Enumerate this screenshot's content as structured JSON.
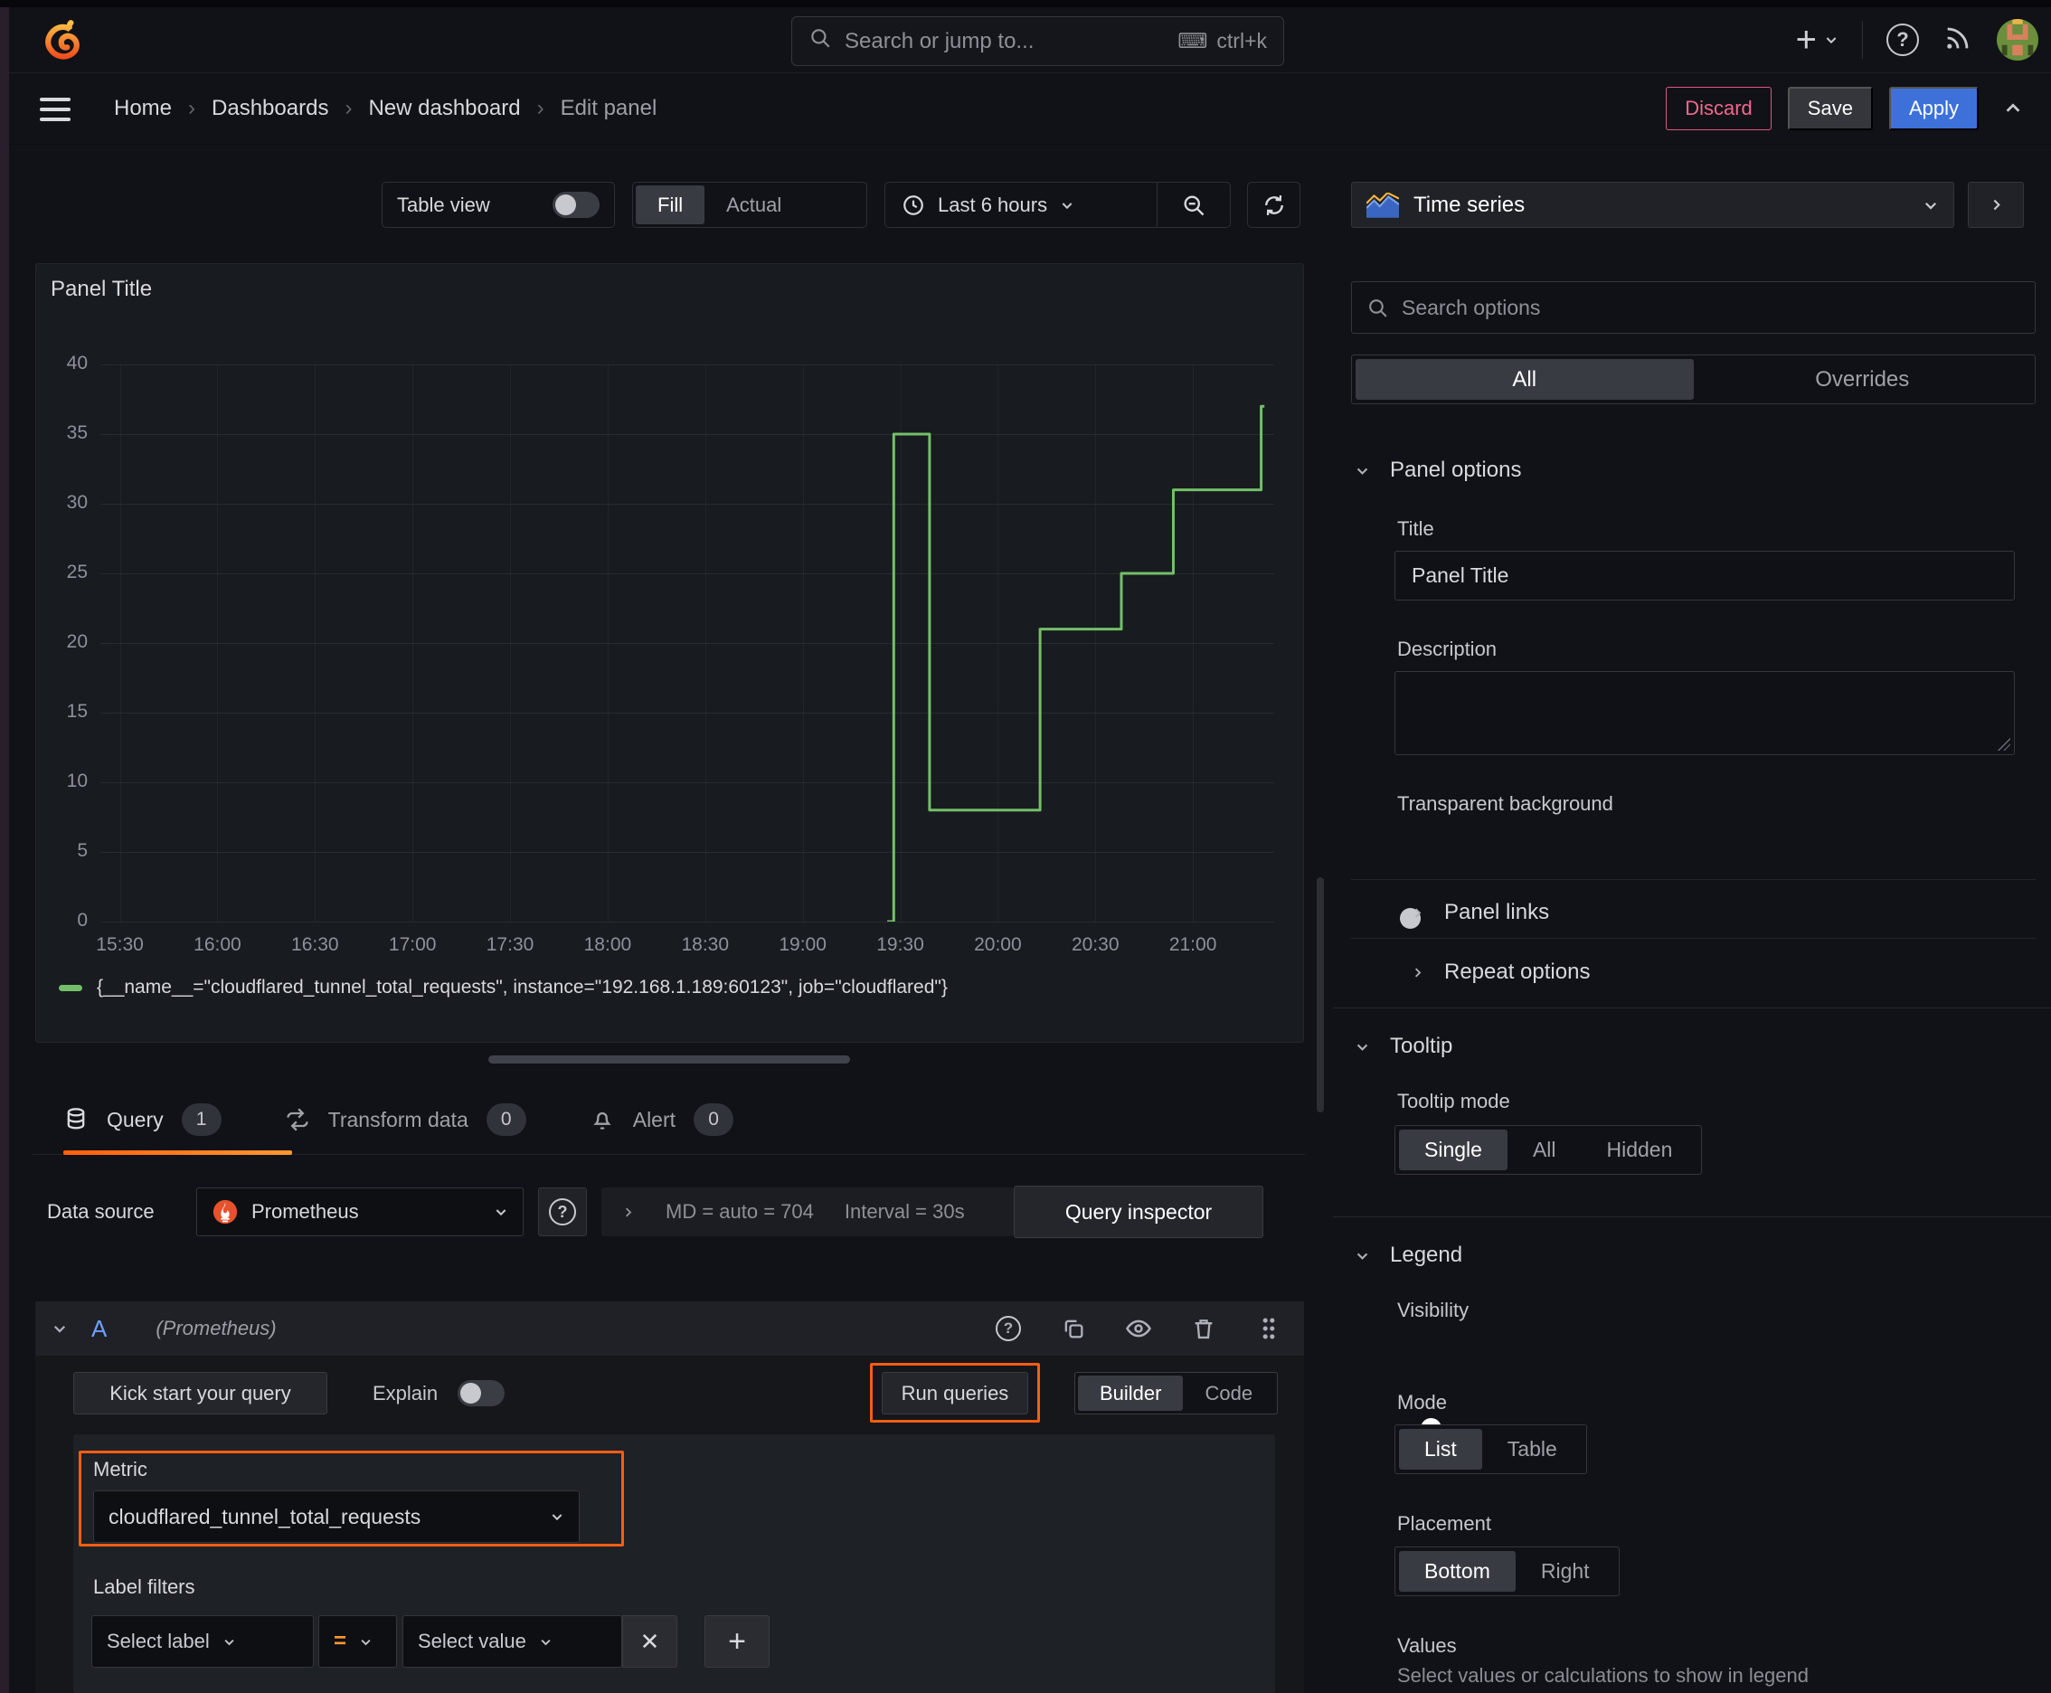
{
  "colors": {
    "accent_orange": "#f55e13",
    "series_green": "#73bf69",
    "primary_blue": "#3d71d9",
    "danger_pink": "#f1688f",
    "tab_underline_from": "#ff5f0e",
    "tab_underline_to": "#ff9830"
  },
  "topnav": {
    "search_placeholder": "Search or jump to...",
    "shortcut": "ctrl+k"
  },
  "breadcrumb": {
    "items": [
      "Home",
      "Dashboards",
      "New dashboard",
      "Edit panel"
    ]
  },
  "actions": {
    "discard": "Discard",
    "save": "Save",
    "apply": "Apply"
  },
  "panel_toolbar": {
    "table_view_label": "Table view",
    "fit_options": [
      "Fill",
      "Actual"
    ],
    "fit_selected": "Fill",
    "time_range": "Last 6 hours"
  },
  "viz_picker": {
    "label": "Time series"
  },
  "panel": {
    "title": "Panel Title"
  },
  "chart_data": {
    "type": "line",
    "step": true,
    "title": "Panel Title",
    "xlabel": "",
    "ylabel": "",
    "grid": true,
    "legend_position": "bottom",
    "x_ticks": [
      "15:30",
      "16:00",
      "16:30",
      "17:00",
      "17:30",
      "18:00",
      "18:30",
      "19:00",
      "19:30",
      "20:00",
      "20:30",
      "21:00"
    ],
    "x_domain_minutes": [
      924,
      1285
    ],
    "y_ticks": [
      0,
      5,
      10,
      15,
      20,
      25,
      30,
      35,
      40
    ],
    "ylim": [
      0,
      40
    ],
    "series": [
      {
        "name": "{__name__=\"cloudflared_tunnel_total_requests\", instance=\"192.168.1.189:60123\", job=\"cloudflared\"}",
        "color": "#73bf69",
        "points": [
          {
            "t": "19:26",
            "v": 0
          },
          {
            "t": "19:28",
            "v": 0
          },
          {
            "t": "19:28",
            "v": 35
          },
          {
            "t": "19:39",
            "v": 35
          },
          {
            "t": "19:39",
            "v": 8
          },
          {
            "t": "20:13",
            "v": 8
          },
          {
            "t": "20:13",
            "v": 21
          },
          {
            "t": "20:38",
            "v": 21
          },
          {
            "t": "20:38",
            "v": 25
          },
          {
            "t": "20:54",
            "v": 25
          },
          {
            "t": "20:54",
            "v": 31
          },
          {
            "t": "21:21",
            "v": 31
          },
          {
            "t": "21:21",
            "v": 37
          },
          {
            "t": "21:22",
            "v": 37
          }
        ]
      }
    ]
  },
  "editor": {
    "tabs": [
      {
        "label": "Query",
        "count": "1"
      },
      {
        "label": "Transform data",
        "count": "0"
      },
      {
        "label": "Alert",
        "count": "0"
      }
    ],
    "datasource": {
      "label": "Data source",
      "name": "Prometheus",
      "stats_md": "MD = auto = 704",
      "stats_interval": "Interval = 30s",
      "query_inspector": "Query inspector"
    },
    "query": {
      "ref_id": "A",
      "ds_hint": "(Prometheus)",
      "kick_start": "Kick start your query",
      "explain": "Explain",
      "run_queries": "Run queries",
      "mode_options": [
        "Builder",
        "Code"
      ],
      "mode_selected": "Builder",
      "metric_label": "Metric",
      "metric_value": "cloudflared_tunnel_total_requests",
      "label_filters_label": "Label filters",
      "select_label_placeholder": "Select label",
      "operator": "=",
      "select_value_placeholder": "Select value"
    }
  },
  "options_pane": {
    "search_placeholder": "Search options",
    "tabs": [
      "All",
      "Overrides"
    ],
    "tab_selected": "All",
    "panel_options": {
      "heading": "Panel options",
      "title_label": "Title",
      "title_value": "Panel Title",
      "description_label": "Description",
      "transparent_label": "Transparent background"
    },
    "collapsed_sections": [
      "Panel links",
      "Repeat options"
    ],
    "tooltip": {
      "heading": "Tooltip",
      "mode_label": "Tooltip mode",
      "modes": [
        "Single",
        "All",
        "Hidden"
      ],
      "mode_selected": "Single"
    },
    "legend": {
      "heading": "Legend",
      "visibility_label": "Visibility",
      "mode_label": "Mode",
      "modes": [
        "List",
        "Table"
      ],
      "mode_selected": "List",
      "placement_label": "Placement",
      "placements": [
        "Bottom",
        "Right"
      ],
      "placement_selected": "Bottom",
      "values_label": "Values",
      "values_hint": "Select values or calculations to show in legend"
    }
  }
}
